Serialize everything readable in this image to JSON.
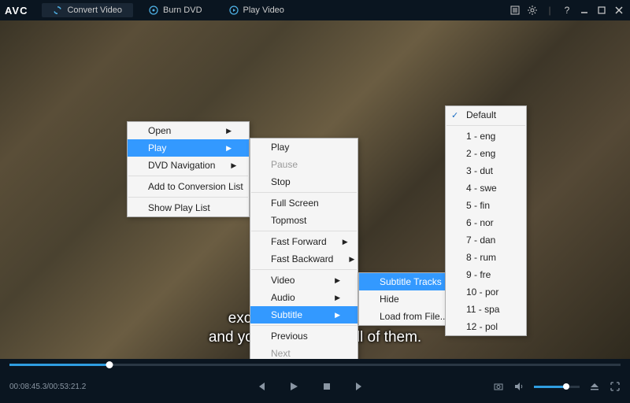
{
  "app": {
    "logo": "AVC"
  },
  "tabs": {
    "convert": "Convert Video",
    "burn": "Burn DVD",
    "play": "Play Video"
  },
  "subtitle": {
    "line1": "except you                      nds of children",
    "line2": "and you worry about all of them."
  },
  "menu1": {
    "open": "Open",
    "play": "Play",
    "dvd": "DVD Navigation",
    "add": "Add to Conversion List",
    "show": "Show Play List"
  },
  "menu2": {
    "play": "Play",
    "pause": "Pause",
    "stop": "Stop",
    "fullscreen": "Full Screen",
    "topmost": "Topmost",
    "ff": "Fast Forward",
    "fb": "Fast Backward",
    "video": "Video",
    "audio": "Audio",
    "subtitle": "Subtitle",
    "prev": "Previous",
    "next": "Next"
  },
  "menu3": {
    "tracks": "Subtitle Tracks",
    "hide": "Hide",
    "load": "Load from File..."
  },
  "menu4": {
    "default": "Default",
    "t1": "1 - eng",
    "t2": "2 - eng",
    "t3": "3 - dut",
    "t4": "4 - swe",
    "t5": "5 - fin",
    "t6": "6 - nor",
    "t7": "7 - dan",
    "t8": "8 - rum",
    "t9": "9 - fre",
    "t10": "10 - por",
    "t11": "11 - spa",
    "t12": "12 - pol"
  },
  "playback": {
    "elapsed": "00:08:45.3",
    "total": "00:53:21.2",
    "progress_pct": 16.4,
    "volume_pct": 70
  },
  "colors": {
    "accent": "#3399ff",
    "progress": "#2f9de0",
    "bg": "#0a1520"
  }
}
